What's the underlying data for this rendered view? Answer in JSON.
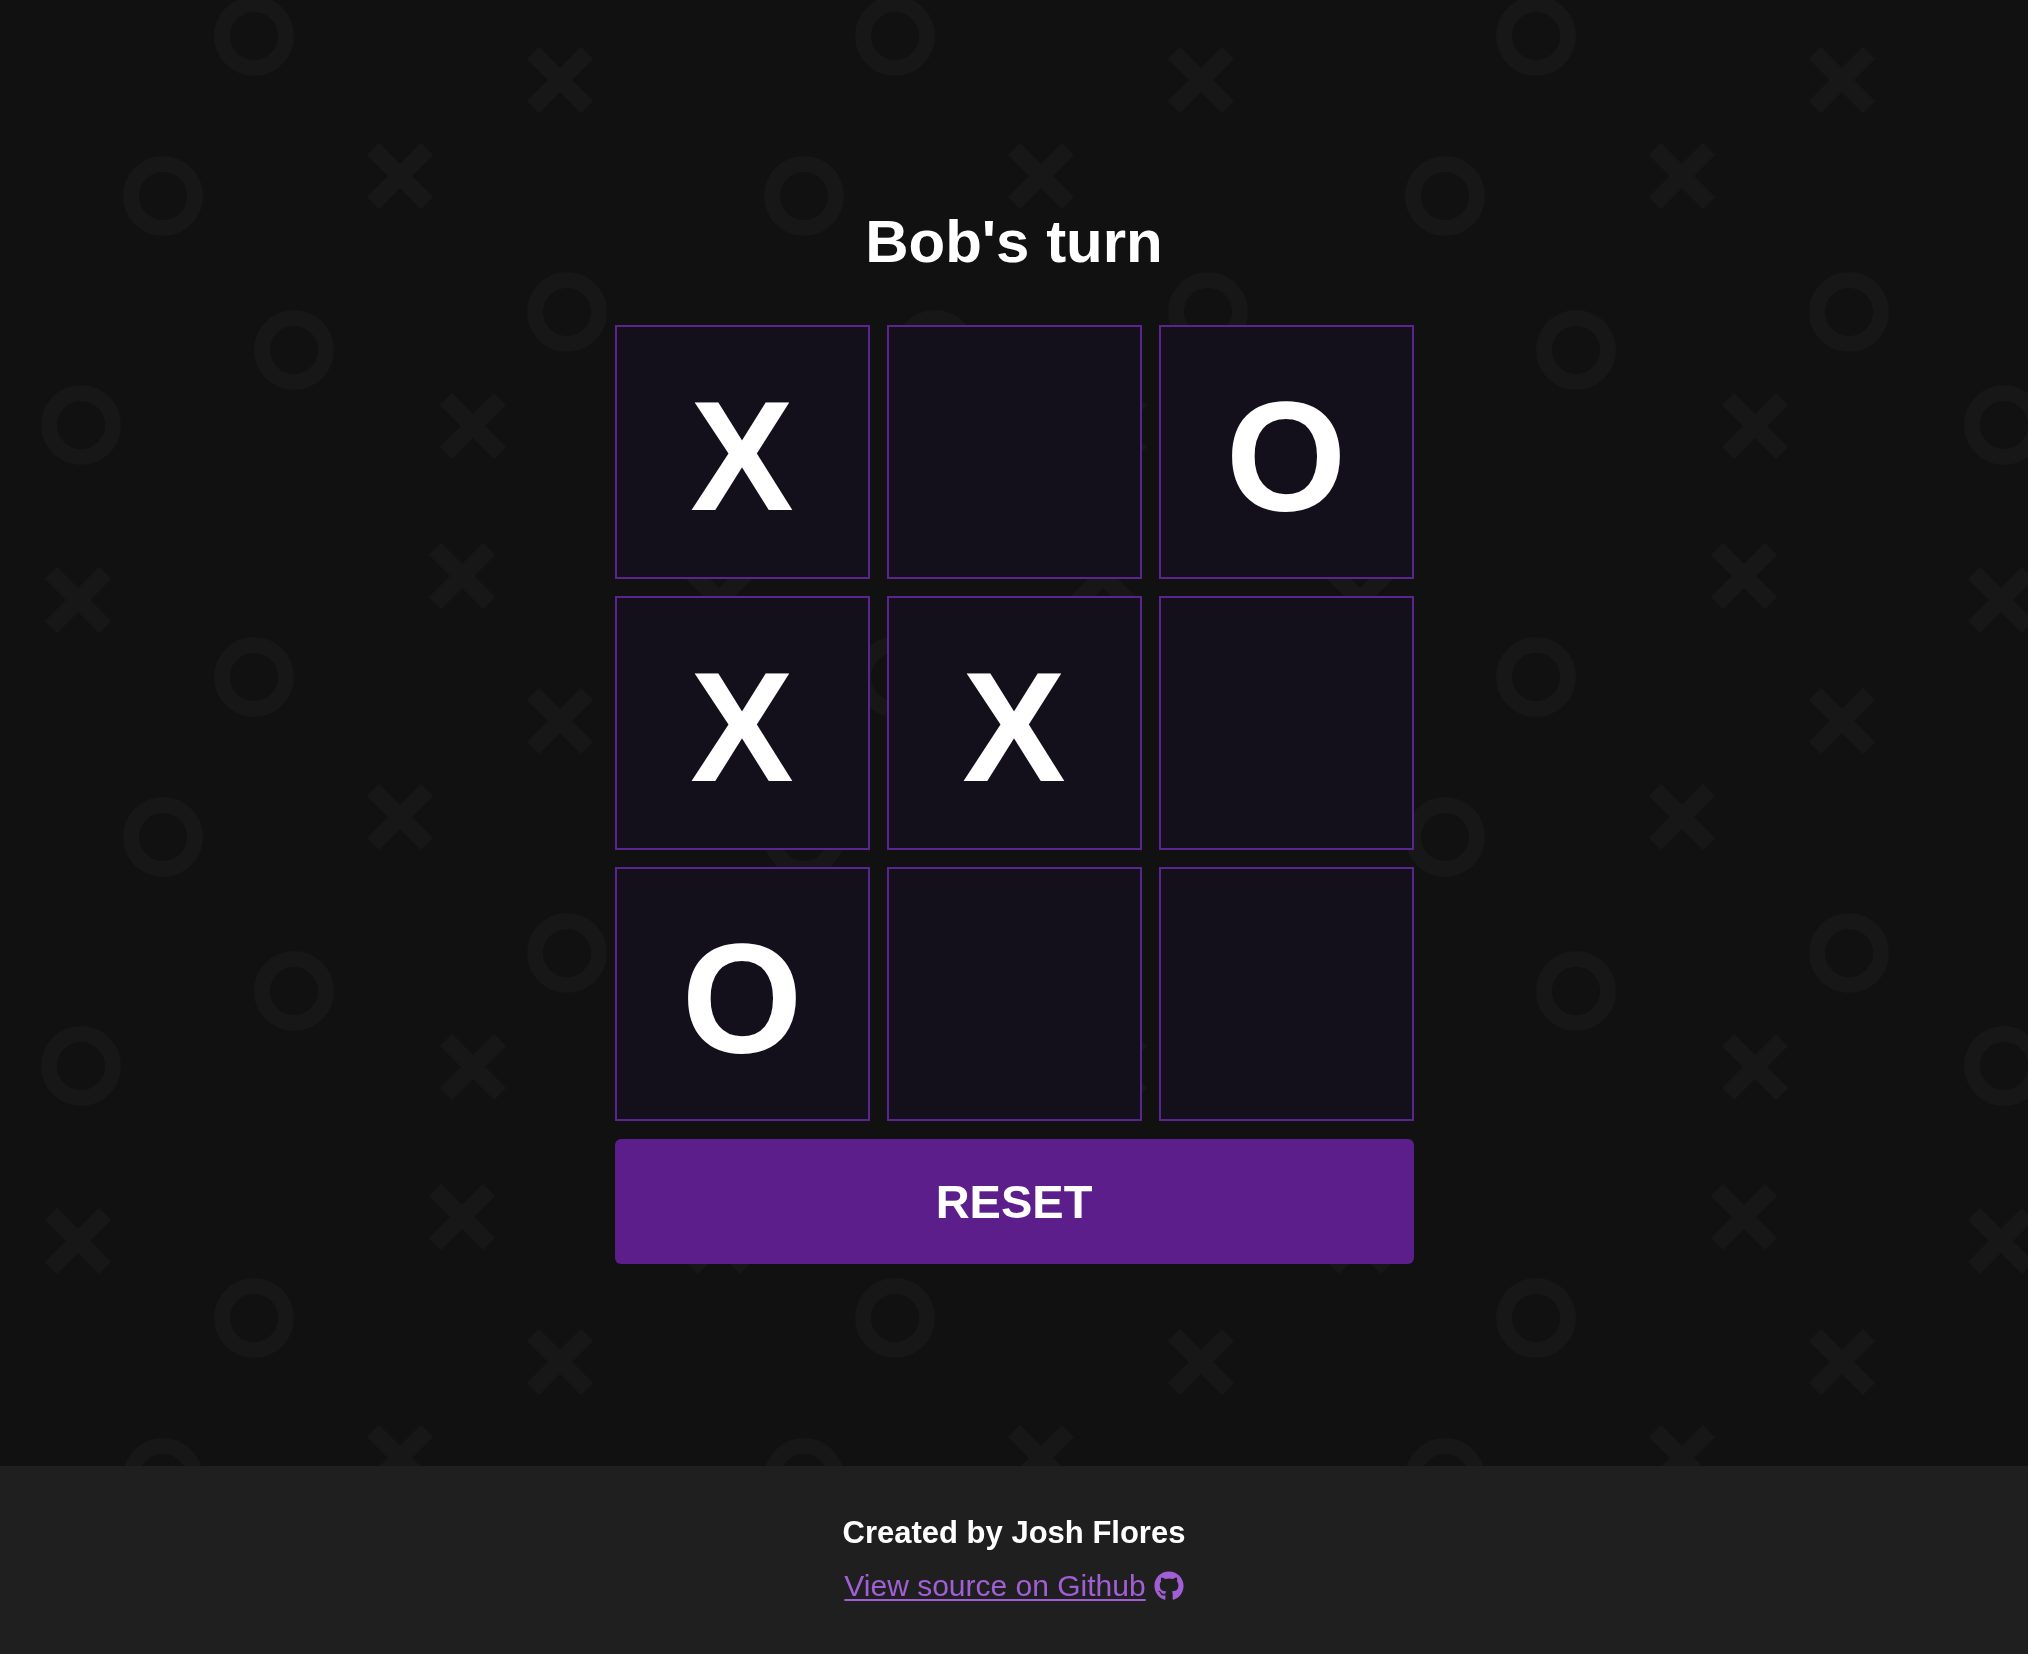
{
  "title": "Bob's turn",
  "board": [
    {
      "column_1": "X",
      "column_3": "O"
    },
    {
      "column_1": "X",
      "column_2": "X"
    },
    {
      "column_1": "O"
    }
  ],
  "reset_button": {
    "label": "RESET"
  },
  "footer": {
    "credit": "Created by Josh Flores",
    "source_link": {
      "label": "View source on Github"
    }
  }
}
